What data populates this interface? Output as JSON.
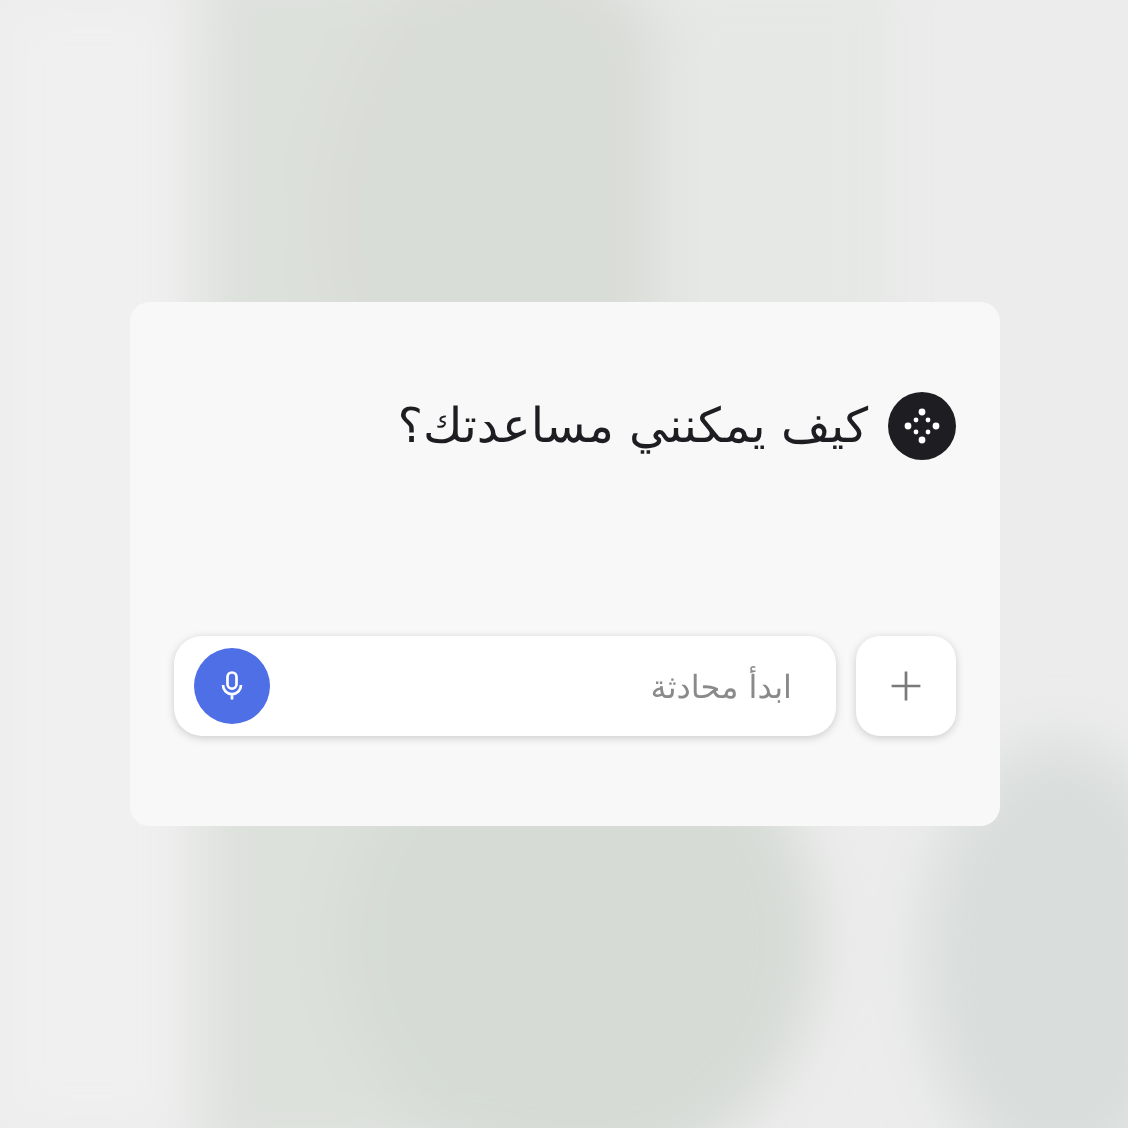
{
  "prompt": {
    "heading": "كيف يمكنني مساعدتك؟"
  },
  "composer": {
    "placeholder": "ابدأ محادثة"
  }
}
